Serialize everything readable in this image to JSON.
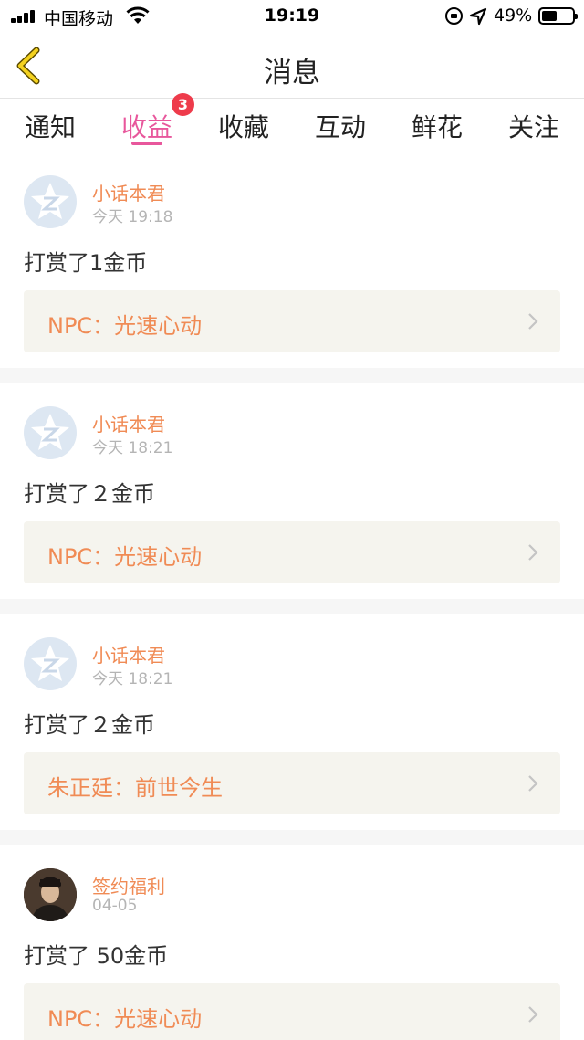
{
  "status_bar": {
    "carrier": "中国移动",
    "time": "19:19",
    "battery_percent": "49%",
    "battery_level": 0.49,
    "icons": [
      "signal-icon",
      "wifi-icon",
      "orientation-lock-icon",
      "location-icon",
      "battery-icon"
    ]
  },
  "nav": {
    "title": "消息",
    "back_icon": "chevron-left-icon"
  },
  "tabs": {
    "items": [
      {
        "label": "通知"
      },
      {
        "label": "收益",
        "badge": "3"
      },
      {
        "label": "收藏"
      },
      {
        "label": "互动"
      },
      {
        "label": "鲜花"
      },
      {
        "label": "关注"
      }
    ],
    "active": "收益"
  },
  "colors": {
    "accent": "#e8579c",
    "username": "#f08b55",
    "badge": "#ee3b4b",
    "card_link_bg": "#f5f4ee"
  },
  "messages": [
    {
      "avatar": "default-avatar-icon",
      "username": "小话本君",
      "time": "今天 19:18",
      "text": "打赏了1金币",
      "book": "NPC：光速心动"
    },
    {
      "avatar": "default-avatar-icon",
      "username": "小话本君",
      "time": "今天 18:21",
      "text": "打赏了２金币",
      "book": "NPC：光速心动"
    },
    {
      "avatar": "default-avatar-icon",
      "username": "小话本君",
      "time": "今天 18:21",
      "text": "打赏了２金币",
      "book": "朱正廷：前世今生"
    },
    {
      "avatar": "photo-avatar",
      "username": "签约福利",
      "time": "04-05",
      "text": "打赏了 50金币",
      "book": "NPC：光速心动"
    }
  ]
}
